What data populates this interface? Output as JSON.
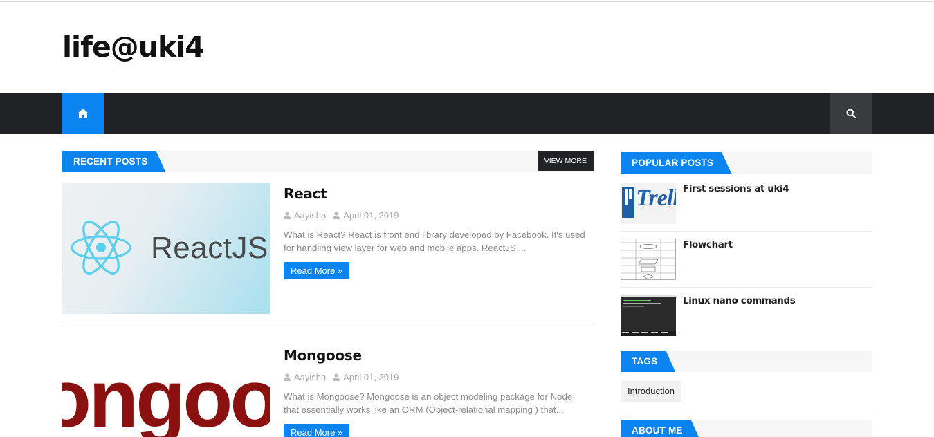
{
  "site": {
    "title": "life@uki4"
  },
  "nav": {
    "home_icon": "home-icon",
    "search_icon": "search-icon"
  },
  "recent": {
    "heading": "RECENT POSTS",
    "view_more": "VIEW MORE",
    "posts": [
      {
        "title": "React",
        "author": "Aayisha",
        "date": "April 01, 2019",
        "excerpt": "What is React? React is front end library developed by Facebook. It's used for handling view layer for web and mobile apps. ReactJS ...",
        "read_more": "Read More »",
        "thumb_text": "ReactJS"
      },
      {
        "title": "Mongoose",
        "author": "Aayisha",
        "date": "April 01, 2019",
        "excerpt": "What is Mongoose? Mongoose is an object modeling package for Node that essentially works like an ORM (Object-relational mapping ) that...",
        "read_more": "Read More »",
        "thumb_text": "ongoo"
      }
    ]
  },
  "popular": {
    "heading": "POPULAR POSTS",
    "items": [
      {
        "title": "First sessions at uki4",
        "thumb_text": "Trello"
      },
      {
        "title": "Flowchart"
      },
      {
        "title": "Linux nano commands"
      }
    ]
  },
  "tags": {
    "heading": "TAGS",
    "items": [
      "Introduction"
    ]
  },
  "about": {
    "heading": "ABOUT ME"
  },
  "colors": {
    "accent": "#0a84f0",
    "nav_bg": "#212226",
    "react_blue": "#5ccfee",
    "mongoose_red": "#8b1010"
  }
}
